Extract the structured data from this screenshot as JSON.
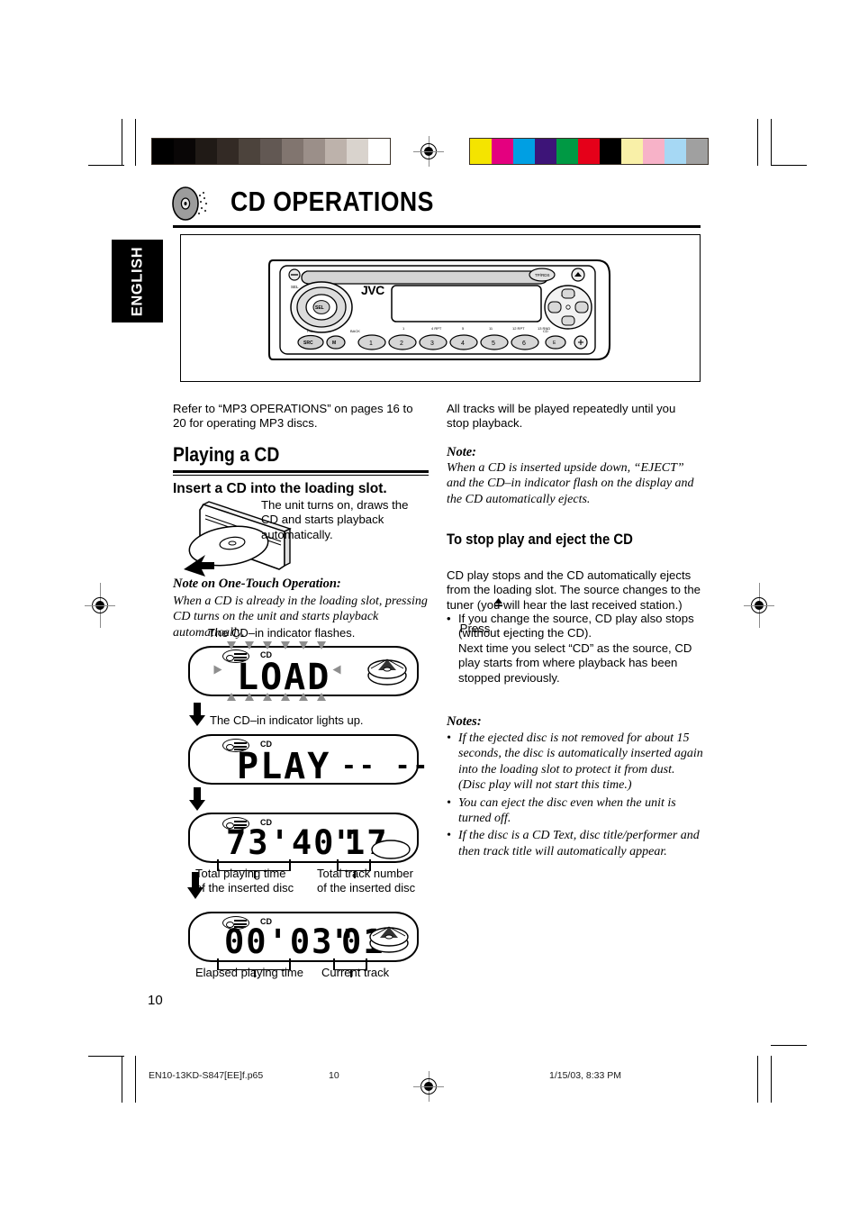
{
  "meta": {
    "page_number": "10",
    "language_tab": "ENGLISH"
  },
  "chapter": {
    "title": "CD OPERATIONS",
    "icon": "cd-disc-icon"
  },
  "unit_illustration": {
    "brand": "JVC",
    "alt": "jvc-car-stereo-faceplate",
    "preset_buttons": [
      "1",
      "2",
      "3",
      "4",
      "5",
      "6"
    ],
    "display_hints": [
      "1",
      "4  RPT",
      "5",
      "11",
      "12 RPT",
      "13 RND"
    ]
  },
  "left_column": {
    "intro": "Refer to “MP3 OPERATIONS” on pages 16 to 20 for operating MP3 discs.",
    "section_heading": "Playing a CD",
    "step_heading": "Insert a CD into the loading slot.",
    "step_caption": "The unit turns on, draws the CD and starts playback automatically.",
    "note_one_touch_heading": "Note on One-Touch Operation:",
    "note_one_touch_body": "When a CD is already in the loading slot, pressing CD turns on the unit and starts playback automatically.",
    "flash_caption": "The CD–in indicator flashes.",
    "lights_caption": "The CD–in indicator lights up."
  },
  "lcd_panels": [
    {
      "name": "lcd-load",
      "cd_label": "CD",
      "segment_text": "LOAD",
      "secondary": "",
      "flashing": true,
      "has_disc_icon": true
    },
    {
      "name": "lcd-play",
      "cd_label": "CD",
      "segment_text": "PLAY",
      "secondary": "-- --",
      "flashing": false,
      "has_disc_icon": false
    },
    {
      "name": "lcd-total",
      "cd_label": "CD",
      "segment_text": "73'40\"",
      "secondary": "17",
      "flashing": false,
      "has_disc_icon": true,
      "caption_left": "Total playing time\nof the inserted disc",
      "caption_right": "Total track number\nof the inserted disc"
    },
    {
      "name": "lcd-elapsed",
      "cd_label": "CD",
      "segment_text": "00'03\"",
      "secondary": "01",
      "flashing": false,
      "has_disc_icon": true,
      "caption_left": "Elapsed playing time",
      "caption_right": "Current track"
    }
  ],
  "right_column": {
    "intro": "All tracks will be played repeatedly until you stop playback.",
    "note_heading": "Note:",
    "note_body": "When a CD is inserted upside down, “EJECT” and the CD–in indicator flash on the display and the CD automatically ejects.",
    "section_heading": "To stop play and eject the CD",
    "press_line_prefix": "Press ",
    "press_line_suffix": ".",
    "press_icon": "eject-icon",
    "body": "CD play stops and the CD automatically ejects from the loading slot. The source changes to the tuner (you will hear the last received station.)",
    "bullets": [
      "If you change the source, CD play also stops (without ejecting the CD).\nNext time you select “CD” as the source, CD play starts from where playback has been stopped previously."
    ],
    "notes_heading": "Notes:",
    "notes": [
      "If the ejected disc is not removed for about 15 seconds, the disc is automatically inserted again into the loading slot to protect it from dust.\n(Disc play will not start this time.)",
      "You can eject the disc even when the unit is turned off.",
      "If the disc is a CD Text, disc title/performer and then track title will automatically appear."
    ]
  },
  "calibration": {
    "grayscale_label": "grayscale-bar",
    "grayscale": [
      "#000000",
      "#090606",
      "#201a16",
      "#332a25",
      "#4c433c",
      "#625853",
      "#81756f",
      "#9b8f89",
      "#bdb2ab",
      "#d9d3cd",
      "#ffffff"
    ],
    "colors_label": "color-bar",
    "colors": [
      "#f4e400",
      "#e4007f",
      "#009fe3",
      "#3d1478",
      "#009944",
      "#e50019",
      "#000000",
      "#f9f0a8",
      "#f7b2c8",
      "#a6d8f4",
      "#a0a0a0"
    ]
  },
  "footer": {
    "filename": "EN10-13KD-S847[EE]f.p65",
    "page": "10",
    "timestamp": "1/15/03, 8:33 PM"
  }
}
